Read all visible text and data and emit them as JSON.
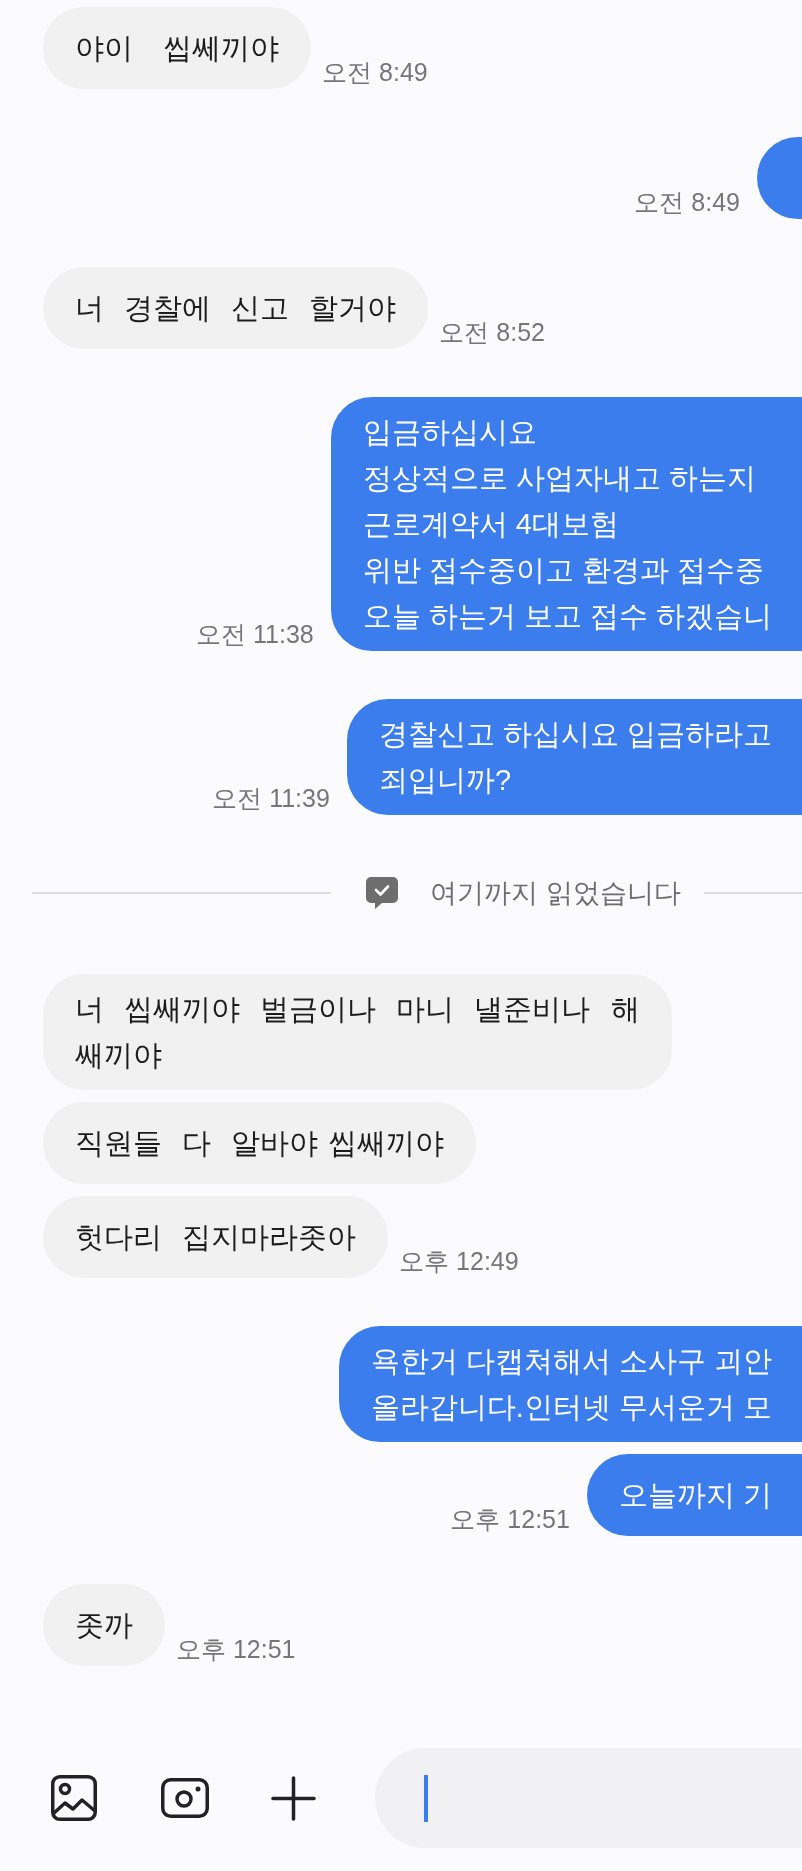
{
  "chat": {
    "items": [
      {
        "kind": "received",
        "text": "야이   씹쎄끼야",
        "time": "오전 8:49"
      },
      {
        "kind": "sent",
        "time": "오전 8:49"
      },
      {
        "kind": "received",
        "text": "너  경찰에  신고  할거야",
        "time": "오전 8:52"
      },
      {
        "kind": "sent",
        "text": "입금하십시요\n정상적으로 사업자내고 하는지\n근로계약서 4대보험\n위반 접수중이고 환경과 접수중\n오늘 하는거 보고 접수 하겠습니",
        "time": "오전 11:38"
      },
      {
        "kind": "sent",
        "text": "경찰신고 하십시요 입금하라고\n죄입니까?",
        "time": "오전 11:39"
      },
      {
        "kind": "divider",
        "text": "여기까지 읽었습니다"
      },
      {
        "kind": "received",
        "text": "너  씹쌔끼야  벌금이나  마니  낼준비나  해\n쌔끼야"
      },
      {
        "kind": "received",
        "text": "직원들  다  알바야 씹쌔끼야"
      },
      {
        "kind": "received",
        "text": "헛다리  집지마라좃아",
        "time": "오후 12:49"
      },
      {
        "kind": "sent",
        "text": "욕한거 다캡쳐해서 소사구 괴안\n올라갑니다.인터넷 무서운거 모"
      },
      {
        "kind": "sent",
        "text": "오늘까지 기",
        "time": "오후 12:51"
      },
      {
        "kind": "received",
        "text": "좃까",
        "time": "오후 12:51"
      }
    ]
  },
  "composer": {
    "focused": true
  }
}
